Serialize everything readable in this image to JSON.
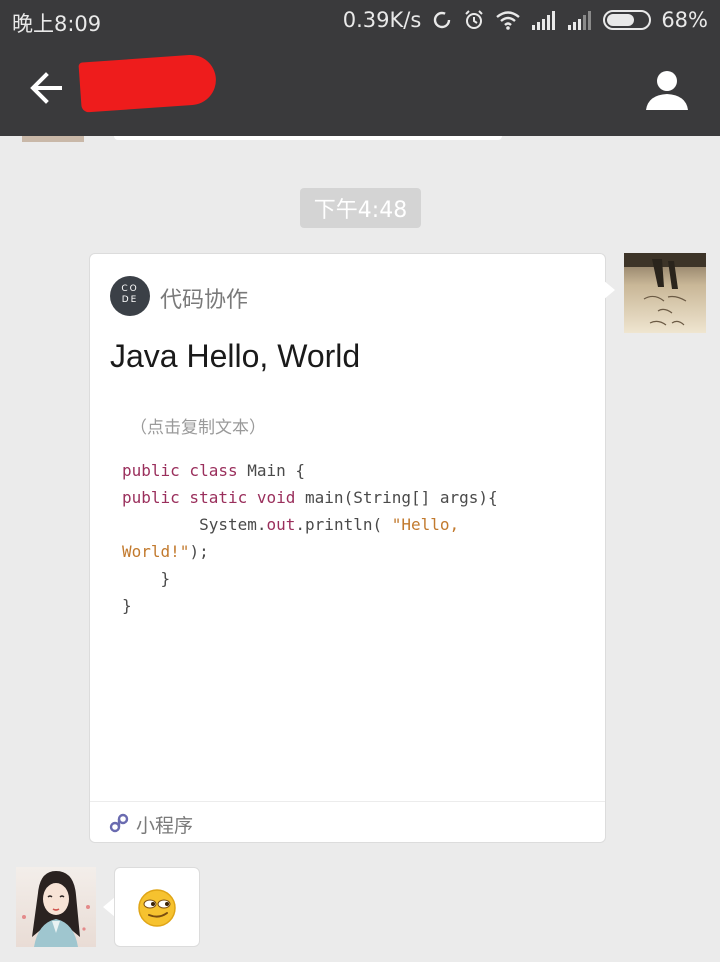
{
  "status_bar": {
    "time": "晚上8:09",
    "speed": "0.39K/s",
    "battery": "68%",
    "battery_level": 0.68
  },
  "nav": {
    "back_icon": "back-arrow-icon",
    "contact_icon": "person-icon"
  },
  "chat": {
    "timestamp": "下午4:48",
    "card": {
      "app_name": "代码协作",
      "logo_text_top": "CO",
      "logo_text_bottom": "DE",
      "title": "Java Hello, World",
      "copy_hint": "（点击复制文本）",
      "code": {
        "line1_kw": "public class ",
        "line1_rest": "Main {",
        "line2_kw": "public static void ",
        "line2_rest": "main(String[] args){",
        "line3": "        System.",
        "line3_out": "out",
        "line3_rest": ".println( ",
        "line3_str": "\"Hello,",
        "line4_str": "World!\"",
        "line4_rest": ");",
        "line5": "    }",
        "line6": "}"
      },
      "footer_label": "小程序"
    }
  },
  "colors": {
    "bar": "#3a3a3c",
    "background": "#ebebeb",
    "keyword": "#9a2f5c",
    "string": "#c27a2e",
    "redaction": "#ee1c1c"
  }
}
